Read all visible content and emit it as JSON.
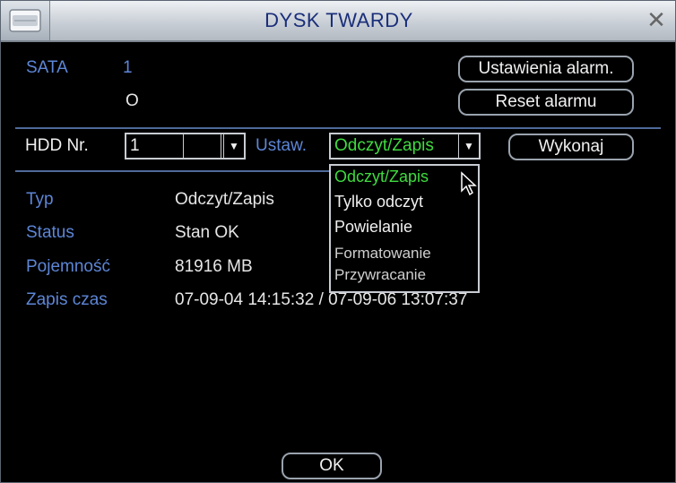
{
  "window": {
    "title": "DYSK TWARDY"
  },
  "disk": {
    "sata_label": "SATA",
    "sata_number": "1",
    "sata_status": "O"
  },
  "buttons": {
    "alarm_settings": "Ustawienia alarm.",
    "reset_alarm": "Reset alarmu",
    "execute": "Wykonaj",
    "ok": "OK"
  },
  "hdd": {
    "label": "HDD Nr.",
    "number": "1",
    "set_label": "Ustaw.",
    "set_value": "Odczyt/Zapis"
  },
  "dropdown_options": [
    "Odczyt/Zapis",
    "Tylko odczyt",
    "Powielanie",
    "Formatowanie",
    "Przywracanie"
  ],
  "info": {
    "type_label": "Typ",
    "type_value": "Odczyt/Zapis",
    "status_label": "Status",
    "status_value": "Stan OK",
    "capacity_label": "Pojemność",
    "capacity_value": "81916 MB",
    "record_label": "Zapis czas",
    "record_value": "07-09-04 14:15:32 / 07-09-06 13:07:37"
  },
  "colors": {
    "label_blue": "#5d86d6",
    "selected_green": "#3fdc3f",
    "title_blue": "#1a2e7a"
  }
}
